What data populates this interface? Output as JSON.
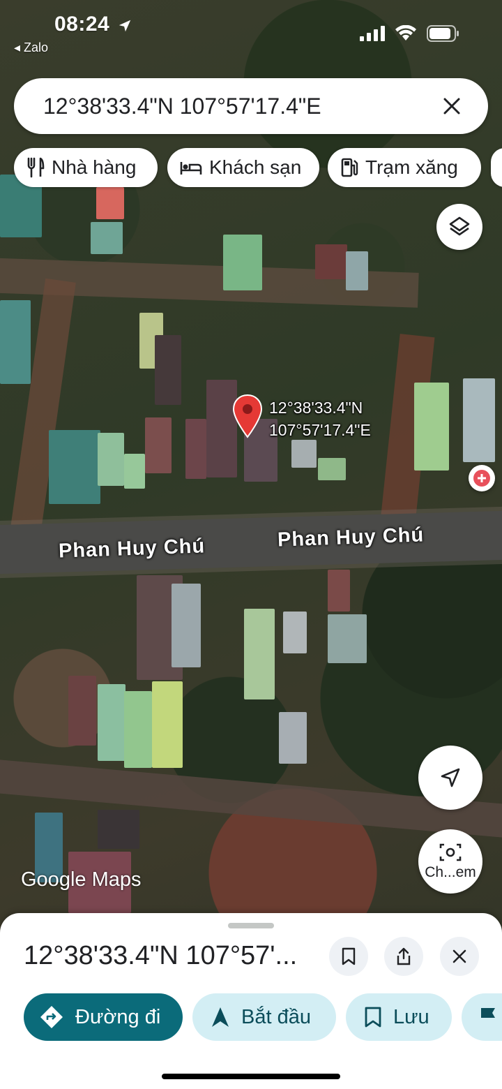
{
  "status_bar": {
    "time": "08:24",
    "back_app": "◂ Zalo"
  },
  "search": {
    "value": "12°38'33.4\"N 107°57'17.4\"E"
  },
  "chips": [
    {
      "label": "Nhà hàng",
      "icon": "restaurant-icon"
    },
    {
      "label": "Khách sạn",
      "icon": "hotel-icon"
    },
    {
      "label": "Trạm xăng",
      "icon": "gas-station-icon"
    }
  ],
  "map": {
    "pin_label_line1": "12°38'33.4\"N",
    "pin_label_line2": "107°57'17.4\"E",
    "road_labels": [
      "Phan Huy Chú",
      "Phan Huy Chú"
    ],
    "attribution": "Google Maps",
    "camera_button_label": "Ch...em"
  },
  "sheet": {
    "title": "12°38'33.4\"N 107°57'...",
    "actions": {
      "directions": "Đường đi",
      "start": "Bắt đầu",
      "save": "Lưu"
    }
  },
  "colors": {
    "accent_teal": "#0b6b7a",
    "pill_bg": "#d3eef4",
    "pin_red": "#e53935"
  }
}
